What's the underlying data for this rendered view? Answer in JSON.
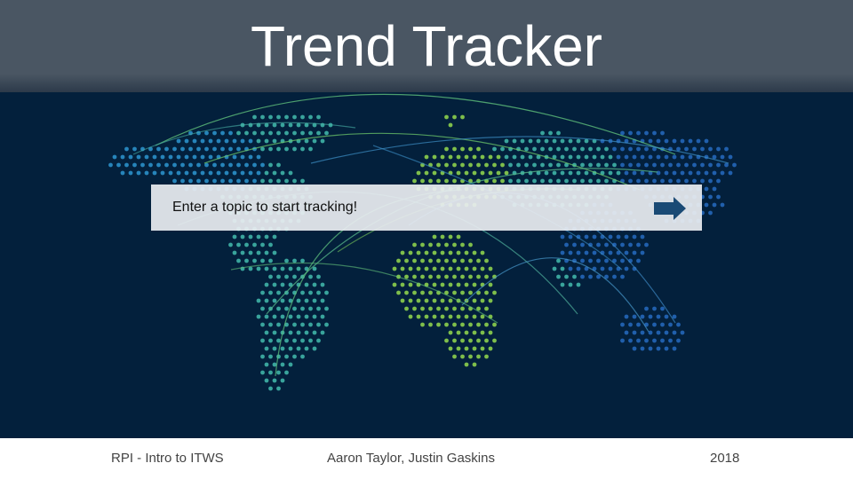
{
  "header": {
    "title": "Trend Tracker"
  },
  "search": {
    "placeholder": "Enter a topic to start tracking!",
    "value": ""
  },
  "submit": {
    "icon": "arrow-right-icon",
    "color": "#1a4a75"
  },
  "footer": {
    "left": "RPI - Intro to ITWS",
    "center": "Aaron Taylor, Justin Gaskins",
    "right": "2018"
  },
  "colors": {
    "header_bg": "#4a5663",
    "map_bg": "#03203c",
    "dots_west": "#2a8fc8",
    "dots_americas": "#3fb3a6",
    "dots_africa_europe": "#8ccf4d",
    "dots_east": "#2466b8"
  }
}
